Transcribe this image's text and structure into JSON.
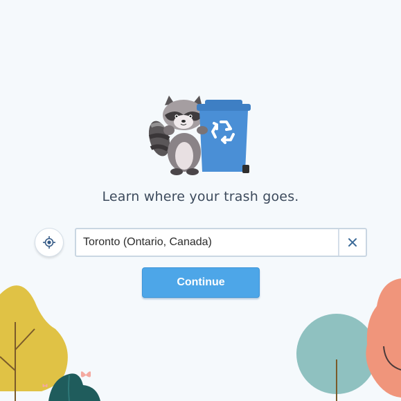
{
  "tagline": "Learn where your trash goes.",
  "search": {
    "value": "Toronto (Ontario, Canada)",
    "clear_icon": "close-icon"
  },
  "locate": {
    "icon": "crosshair-icon"
  },
  "continue_label": "Continue",
  "colors": {
    "background": "#f5f9fc",
    "accent": "#4da6e8",
    "bin": "#4a8fd6",
    "tree_yellow": "#e0c245",
    "tree_teal": "#8fc1c0",
    "tree_salmon": "#f0957b",
    "tree_dark": "#1f5c5c"
  }
}
